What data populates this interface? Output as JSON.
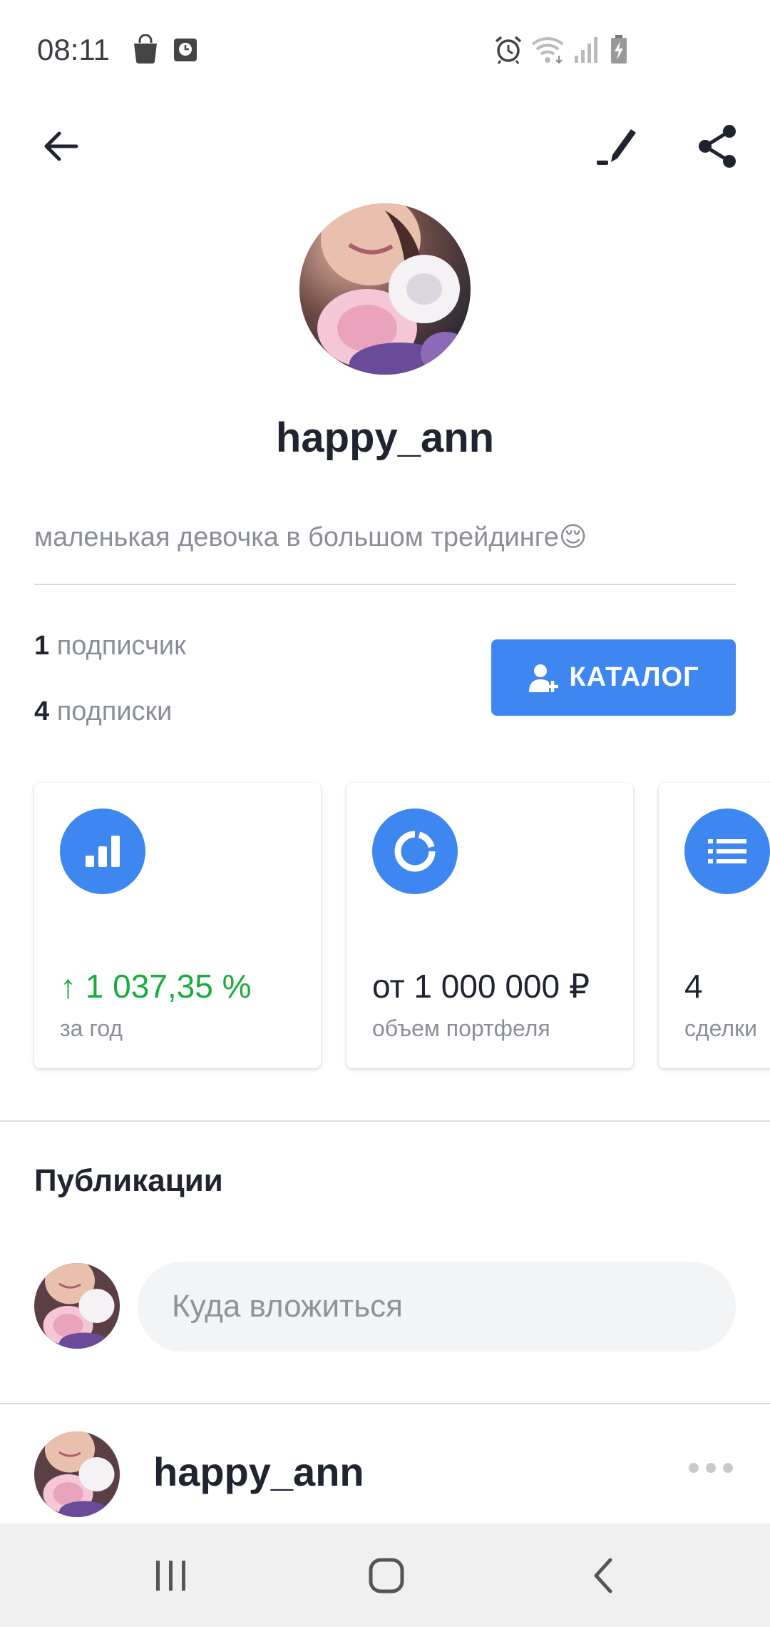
{
  "status_bar": {
    "time": "08:11",
    "icons": [
      "shopping-bag-icon",
      "clock-app-icon",
      "alarm-icon",
      "wifi-icon",
      "cellular-signal-icon",
      "battery-charging-icon"
    ]
  },
  "app_bar": {
    "icons": [
      "back-arrow-icon",
      "edit-pen-icon",
      "share-icon"
    ]
  },
  "profile": {
    "username": "happy_ann",
    "bio": "маленькая девочка в большом трейдинге😌",
    "followers_count": "1",
    "followers_label": "подписчик",
    "following_count": "4",
    "following_label": "подписки",
    "catalog_button": "КАТАЛОГ"
  },
  "stats_cards": [
    {
      "icon": "bar-chart-icon",
      "value_arrow": "↑",
      "value": "1 037,35 %",
      "label": "за год"
    },
    {
      "icon": "donut-chart-icon",
      "value": "от 1 000 000 ₽",
      "label": "объем портфеля"
    },
    {
      "icon": "list-icon",
      "value": "4",
      "label": "сделки"
    }
  ],
  "colors": {
    "accent": "#3f87f0",
    "positive": "#1aab3f",
    "text_primary": "#1f2430",
    "text_secondary": "#8a8e96"
  },
  "publications": {
    "title": "Публикации",
    "compose_placeholder": "Куда вложиться",
    "post_author": "happy_ann"
  },
  "nav_bar": {
    "icons": [
      "recent-apps-icon",
      "home-icon",
      "back-icon"
    ]
  }
}
